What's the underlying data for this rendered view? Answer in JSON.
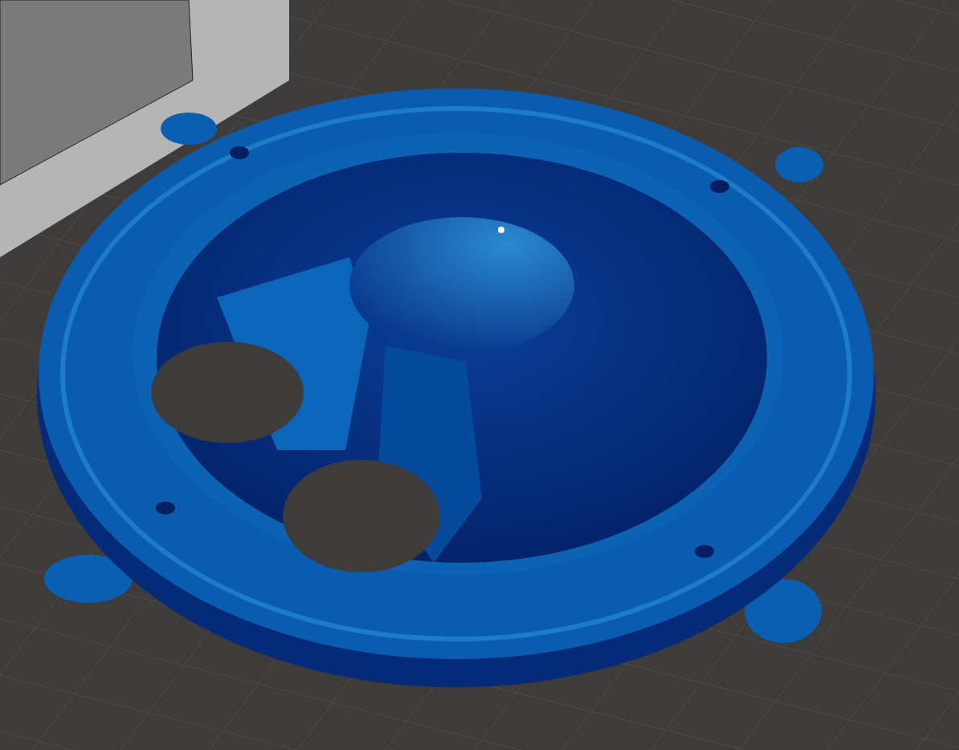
{
  "viewport": {
    "kind": "perspective"
  }
}
